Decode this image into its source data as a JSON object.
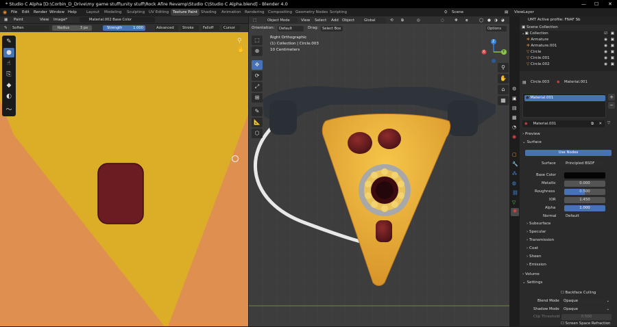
{
  "window": {
    "title": "* Studio C Alpha [D:\\Corbin_D_Drive\\my game stuff\\unity stuff\\Rock Afire Revamp\\Studio C\\Studio C Alpha.blend] - Blender 4.0",
    "minimize": "—",
    "maximize": "☐",
    "close": "✕"
  },
  "menu": {
    "items": [
      "File",
      "Edit",
      "Render",
      "Window",
      "Help"
    ],
    "workspaces": [
      "Layout",
      "Modeling",
      "Sculpting",
      "UV Editing",
      "Texture Paint",
      "Shading",
      "Animation",
      "Rendering",
      "Compositing",
      "Geometry Nodes",
      "Scripting"
    ],
    "active_workspace": "Texture Paint",
    "scene": "Scene",
    "view_layer": "ViewLayer"
  },
  "image_editor": {
    "header": {
      "mode": "Paint",
      "view": "View",
      "image": "Image*",
      "image_name": "Material.002 Base Color"
    },
    "tool_settings": {
      "brush": "Soften",
      "radius_label": "Radius",
      "radius_value": "3 px",
      "strength_label": "Strength",
      "strength_value": "1.000",
      "advanced": "Advanced",
      "stroke": "Stroke",
      "falloff": "Falloff",
      "cursor": "Cursor"
    }
  },
  "viewport": {
    "mode": "Object Mode",
    "view": "View",
    "select": "Select",
    "add": "Add",
    "object": "Object",
    "transform": "Global",
    "orientation_label": "Orientation:",
    "orientation_value": "Default",
    "drag_label": "Drag:",
    "drag_value": "Select Box",
    "options": "Options",
    "overlay_title": "Right Orthographic",
    "overlay_collection": "(1) Collection | Circle.003",
    "overlay_scale": "10 Centimeters",
    "gizmo": {
      "x": "X",
      "y": "Y",
      "z": "Z"
    }
  },
  "outliner": {
    "profile": "UMT Active profile: FNAF Sb",
    "root": "Scene Collection",
    "collection": "Collection",
    "items": [
      "Armature",
      "Armature.001",
      "Circle",
      "Circle.001",
      "Circle.002"
    ]
  },
  "properties": {
    "breadcrumb_object": "Circle.003",
    "breadcrumb_material": "Material.001",
    "slot": "Material.001",
    "material_name": "Material.001",
    "sections": {
      "preview": "Preview",
      "surface": "Surface",
      "subsurface": "Subsurface",
      "specular": "Specular",
      "transmission": "Transmission",
      "coat": "Coat",
      "sheen": "Sheen",
      "emission": "Emission",
      "volume": "Volume",
      "settings": "Settings"
    },
    "use_nodes": "Use Nodes",
    "fields": {
      "surface_label": "Surface",
      "surface_value": "Principled BSDF",
      "base_color_label": "Base Color",
      "base_color_value": "#050505",
      "metallic_label": "Metallic",
      "metallic_value": "0.000",
      "roughness_label": "Roughness",
      "roughness_value": "0.500",
      "ior_label": "IOR",
      "ior_value": "1.450",
      "alpha_label": "Alpha",
      "alpha_value": "1.000",
      "normal_label": "Normal",
      "normal_value": "Default"
    },
    "settings": {
      "backface_culling": "Backface Culling",
      "blend_mode_label": "Blend Mode",
      "blend_mode_value": "Opaque",
      "shadow_mode_label": "Shadow Mode",
      "shadow_mode_value": "Opaque",
      "clip_threshold_label": "Clip Threshold",
      "clip_threshold_value": "0.500",
      "screen_space_refraction": "Screen Space Refraction"
    }
  },
  "colors": {
    "accent": "#4772b3",
    "texture_yellow": "#dcae28",
    "texture_orange": "#df8f4f",
    "pepperoni": "#6b1c22",
    "pizza_cheese": "#f0b63a"
  }
}
